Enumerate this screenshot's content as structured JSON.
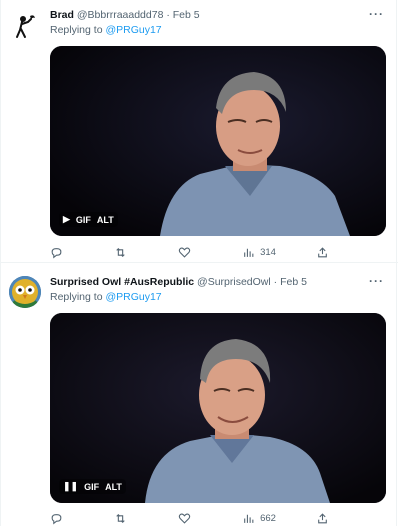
{
  "tweets": [
    {
      "name": "Brad",
      "handle": "@Bbbrrraaaddd78",
      "date": "Feb 5",
      "reply_prefix": "Replying to ",
      "reply_to": "@PRGuy17",
      "media_state_icon": "play-icon",
      "gif_label": "GIF",
      "alt_label": "ALT",
      "views": "314",
      "more_label": "···"
    },
    {
      "name": "Surprised Owl #AusRepublic",
      "handle": "@SurprisedOwl",
      "date": "Feb 5",
      "reply_prefix": "Replying to ",
      "reply_to": "@PRGuy17",
      "media_state_icon": "pause-icon",
      "gif_label": "GIF",
      "alt_label": "ALT",
      "views": "662",
      "more_label": "···"
    }
  ],
  "separator": "·",
  "colors": {
    "link": "#1d9bf0",
    "muted": "#536471",
    "text": "#0f1419",
    "border": "#eff3f4"
  }
}
